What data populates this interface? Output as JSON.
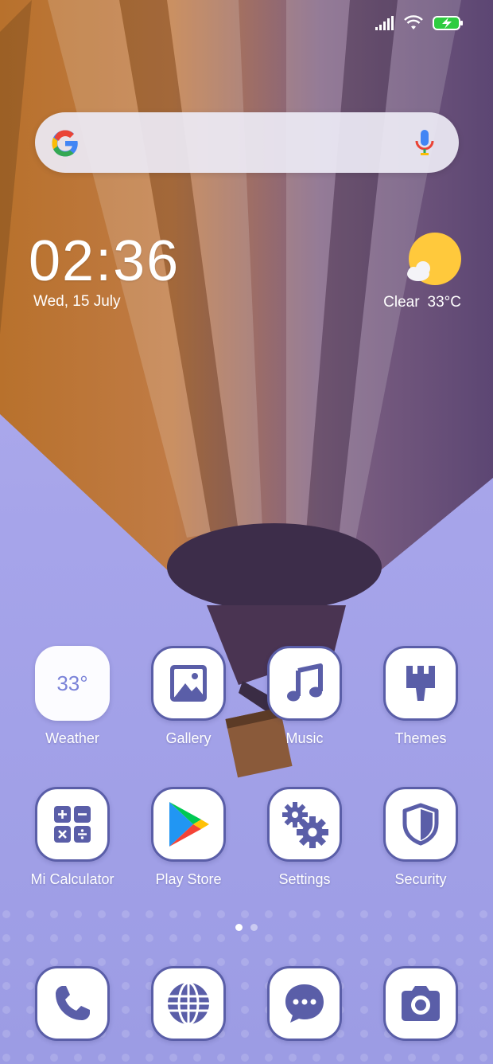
{
  "status_bar": {
    "icons": [
      "signal-icon",
      "wifi-icon",
      "battery-charging-icon"
    ]
  },
  "search": {
    "logo": "google-g-icon",
    "mic": "mic-icon"
  },
  "clock": {
    "time": "02:36",
    "date": "Wed, 15 July"
  },
  "weather": {
    "condition": "Clear",
    "temperature": "33°C",
    "icon": "sun-cloud-icon"
  },
  "apps": [
    {
      "label": "Weather",
      "icon_text": "33°"
    },
    {
      "label": "Gallery",
      "icon": "gallery-icon"
    },
    {
      "label": "Music",
      "icon": "music-note-icon"
    },
    {
      "label": "Themes",
      "icon": "paintbrush-icon"
    },
    {
      "label": "Mi Calculator",
      "icon": "calculator-icon"
    },
    {
      "label": "Play Store",
      "icon": "play-store-icon"
    },
    {
      "label": "Settings",
      "icon": "gears-icon"
    },
    {
      "label": "Security",
      "icon": "shield-icon"
    }
  ],
  "page_indicator": {
    "pages": 2,
    "current": 1
  },
  "dock": [
    {
      "icon": "phone-icon"
    },
    {
      "icon": "browser-globe-icon"
    },
    {
      "icon": "messages-icon"
    },
    {
      "icon": "camera-icon"
    }
  ],
  "colors": {
    "accent": "#5a5ea8",
    "sky": "#9f9fe4",
    "weather_sun": "#ffc93c"
  }
}
